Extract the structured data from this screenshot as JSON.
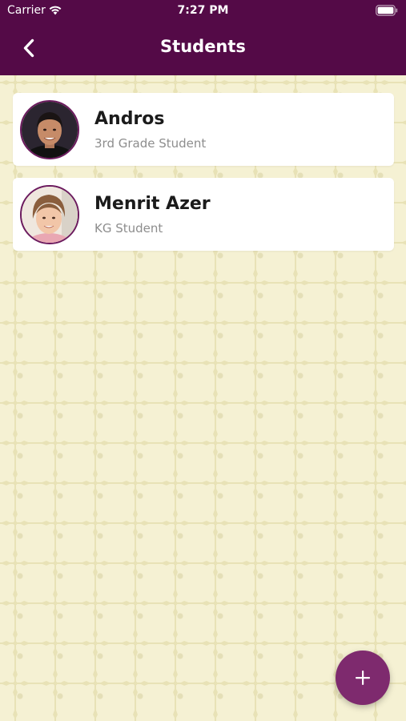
{
  "status_bar": {
    "carrier": "Carrier",
    "time": "7:27 PM",
    "icons": [
      "wifi-icon",
      "battery-icon"
    ]
  },
  "nav": {
    "title": "Students",
    "back_icon": "chevron-left-icon"
  },
  "students": [
    {
      "name": "Andros",
      "grade": "3rd Grade Student"
    },
    {
      "name": "Menrit Azer",
      "grade": "KG Student"
    }
  ],
  "fab": {
    "icon": "plus-icon"
  },
  "colors": {
    "header": "#540a47",
    "fab": "#7e2a6e",
    "background": "#f5f1d3",
    "avatar_border": "#6b1a5e"
  }
}
